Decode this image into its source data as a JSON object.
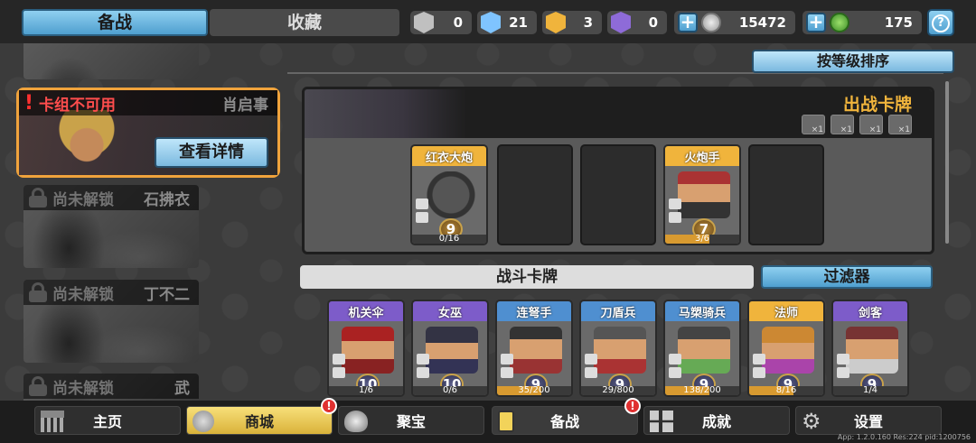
{
  "tabs": {
    "prep": "备战",
    "collection": "收藏"
  },
  "resources": [
    {
      "icon": "silver-gem-icon",
      "color": "#c0c0c0",
      "value": "0"
    },
    {
      "icon": "blue-gem-icon",
      "color": "#7fc4ff",
      "value": "21"
    },
    {
      "icon": "gold-gem-icon",
      "color": "#f0b43c",
      "value": "3"
    },
    {
      "icon": "purple-gem-icon",
      "color": "#8e6bd8",
      "value": "0"
    }
  ],
  "silver_coins": "15472",
  "green_currency": "175",
  "help_label": "?",
  "decks": {
    "selected": {
      "status": "卡组不可用",
      "name": "肖启事",
      "detail_button": "查看详情"
    },
    "locked_status": "尚未解锁",
    "locked": [
      {
        "name": "石拂衣"
      },
      {
        "name": "丁不二"
      },
      {
        "name": "武"
      }
    ]
  },
  "sort_button": "按等级排序",
  "battle_deck": {
    "title": "出战卡牌",
    "modifiers": [
      "×1",
      "×1",
      "×1",
      "×1"
    ],
    "slots": [
      {
        "name": "红衣大炮",
        "level": "9",
        "count": "0/16"
      },
      {
        "name": "火炮手",
        "level": "7",
        "count": "3/6"
      }
    ]
  },
  "battle_cards_tab": "战斗卡牌",
  "filter_button": "过滤器",
  "cards": [
    {
      "name": "机关伞",
      "level": "10",
      "count": "1/6",
      "color": "#7d5cc9"
    },
    {
      "name": "女巫",
      "level": "10",
      "count": "0/6",
      "color": "#7d5cc9"
    },
    {
      "name": "连弩手",
      "level": "9",
      "count": "35/200",
      "color": "#4f8fd0"
    },
    {
      "name": "刀盾兵",
      "level": "9",
      "count": "29/800",
      "color": "#4f8fd0"
    },
    {
      "name": "马槊骑兵",
      "level": "9",
      "count": "138/200",
      "color": "#4f8fd0"
    },
    {
      "name": "法师",
      "level": "9",
      "count": "8/16",
      "color": "#f0b43c"
    },
    {
      "name": "剑客",
      "level": "9",
      "count": "1/4",
      "color": "#7d5cc9"
    }
  ],
  "nav": {
    "home": "主页",
    "shop": "商城",
    "treasure": "聚宝",
    "prep": "备战",
    "achievements": "成就",
    "settings": "设置",
    "badge_mark": "!"
  },
  "version": "App: 1.2.0.160 Res:224 pid:1200756"
}
